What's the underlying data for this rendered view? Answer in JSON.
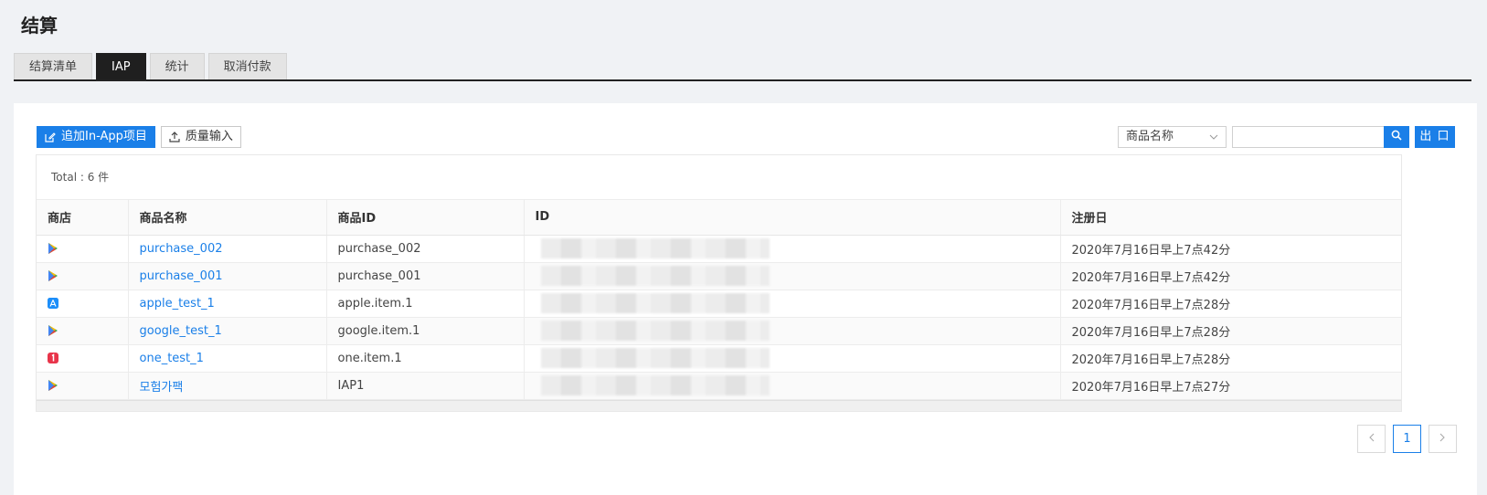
{
  "page": {
    "title": "结算"
  },
  "tabs": [
    {
      "label": "结算清单"
    },
    {
      "label": "IAP"
    },
    {
      "label": "统计"
    },
    {
      "label": "取消付款"
    }
  ],
  "toolbar": {
    "add_label": "追加In-App项目",
    "import_label": "质量输入",
    "search_field_selected": "商品名称",
    "search_value": "",
    "export_label": "出 口"
  },
  "table": {
    "total_label": "Total : 6 件",
    "headers": [
      "商店",
      "商品名称",
      "商品ID",
      "ID",
      "注册日"
    ],
    "rows": [
      {
        "store": "google-play-icon",
        "name": "purchase_002",
        "product_id": "purchase_002",
        "registered": "2020年7月16日早上7点42分"
      },
      {
        "store": "google-play-icon",
        "name": "purchase_001",
        "product_id": "purchase_001",
        "registered": "2020年7月16日早上7点42分"
      },
      {
        "store": "app-store-icon",
        "name": "apple_test_1",
        "product_id": "apple.item.1",
        "registered": "2020年7月16日早上7点28分"
      },
      {
        "store": "google-play-icon",
        "name": "google_test_1",
        "product_id": "google.item.1",
        "registered": "2020年7月16日早上7点28分"
      },
      {
        "store": "one-store-icon",
        "name": "one_test_1",
        "product_id": "one.item.1",
        "registered": "2020年7月16日早上7点28分"
      },
      {
        "store": "google-play-icon",
        "name": "모험가팩",
        "product_id": "IAP1",
        "registered": "2020年7月16日早上7点27分"
      }
    ]
  },
  "pagination": {
    "current": "1"
  },
  "colors": {
    "accent": "#1a7fe8",
    "active_tab": "#1f1f1f"
  }
}
